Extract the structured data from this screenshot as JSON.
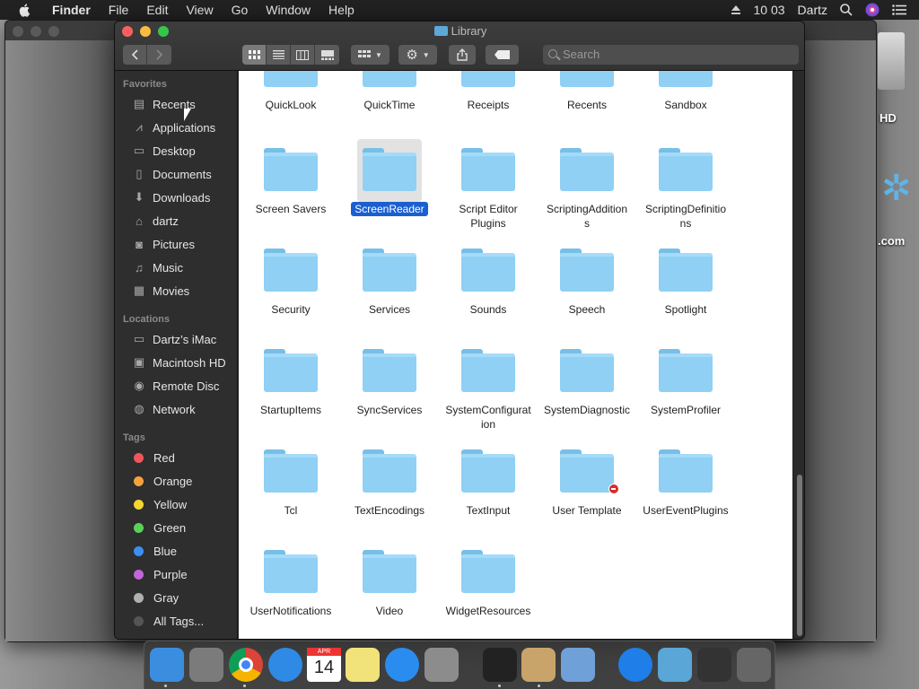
{
  "menubar": {
    "app_name": "Finder",
    "menus": [
      "File",
      "Edit",
      "View",
      "Go",
      "Window",
      "Help"
    ],
    "clock": "10 03",
    "user": "Dartz"
  },
  "desktop": {
    "drive_label": "HD",
    "site_label": ".com"
  },
  "window": {
    "title": "Library",
    "search_placeholder": "Search"
  },
  "sidebar": {
    "favorites_header": "Favorites",
    "favorites": [
      {
        "label": "Recents",
        "icon": "recents-icon"
      },
      {
        "label": "Applications",
        "icon": "applications-icon"
      },
      {
        "label": "Desktop",
        "icon": "desktop-icon"
      },
      {
        "label": "Documents",
        "icon": "documents-icon"
      },
      {
        "label": "Downloads",
        "icon": "downloads-icon"
      },
      {
        "label": "dartz",
        "icon": "home-icon"
      },
      {
        "label": "Pictures",
        "icon": "pictures-icon"
      },
      {
        "label": "Music",
        "icon": "music-icon"
      },
      {
        "label": "Movies",
        "icon": "movies-icon"
      }
    ],
    "locations_header": "Locations",
    "locations": [
      {
        "label": "Dartz’s iMac",
        "icon": "imac-icon"
      },
      {
        "label": "Macintosh HD",
        "icon": "hard-drive-icon"
      },
      {
        "label": "Remote Disc",
        "icon": "disc-icon"
      },
      {
        "label": "Network",
        "icon": "network-icon"
      }
    ],
    "tags_header": "Tags",
    "tags": [
      {
        "label": "Red",
        "color": "#f0565b"
      },
      {
        "label": "Orange",
        "color": "#f6a23b"
      },
      {
        "label": "Yellow",
        "color": "#f5d530"
      },
      {
        "label": "Green",
        "color": "#5bd15a"
      },
      {
        "label": "Blue",
        "color": "#3b8ff2"
      },
      {
        "label": "Purple",
        "color": "#c266d8"
      },
      {
        "label": "Gray",
        "color": "#b0b0b0"
      },
      {
        "label": "All Tags...",
        "color": "#555555"
      }
    ]
  },
  "content": {
    "partial_row": [
      "QuickLook",
      "QuickTime",
      "Receipts",
      "Recents",
      "Sandbox"
    ],
    "rows": [
      [
        "Screen Savers",
        "ScreenReader",
        "Script Editor\nPlugins",
        "ScriptingAddition\ns",
        "ScriptingDefinitio\nns"
      ],
      [
        "Security",
        "Services",
        "Sounds",
        "Speech",
        "Spotlight"
      ],
      [
        "StartupItems",
        "SyncServices",
        "SystemConfigurat\nion",
        "SystemDiagnostic",
        "SystemProfiler"
      ],
      [
        "Tcl",
        "TextEncodings",
        "TextInput",
        "User Template",
        "UserEventPlugins"
      ],
      [
        "UserNotifications",
        "Video",
        "WidgetResources"
      ]
    ],
    "selected": "ScreenReader"
  },
  "dock": {
    "apps": [
      "finder-icon",
      "launchpad-icon",
      "chrome-icon",
      "safari-icon",
      "calendar-icon",
      "notes-icon",
      "app-store-icon",
      "system-preferences-icon",
      "terminal-icon",
      "chess-icon",
      "preview-icon",
      "app-store-folder-icon",
      "folder-icon",
      "disk-utility-icon",
      "trash-icon"
    ],
    "calendar_month": "APR",
    "calendar_day": "14"
  },
  "colors": {
    "selection": "#1a5fcf",
    "folder": "#8fd0f4"
  }
}
